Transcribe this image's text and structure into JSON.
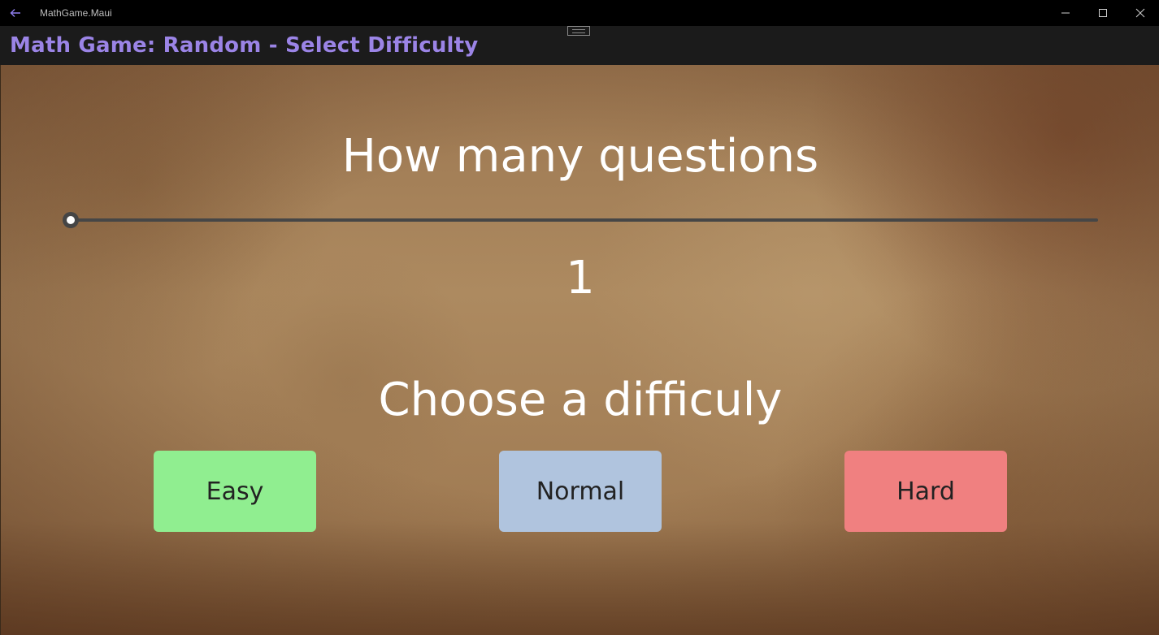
{
  "window": {
    "app_title": "MathGame.Maui",
    "icons": {
      "back": "back-arrow-icon",
      "minimize": "minimize-icon",
      "maximize": "maximize-icon",
      "close": "close-icon"
    },
    "accent_color": "#9b84e6"
  },
  "header": {
    "title": "Math Game: Random - Select Difficulty"
  },
  "main": {
    "questions_heading": "How many questions",
    "questions_slider": {
      "value": 1,
      "minimum": 1,
      "display_value": "1"
    },
    "difficulty_heading": "Choose a difficuly",
    "difficulty_buttons": [
      {
        "label": "Easy",
        "color": "#90ee90"
      },
      {
        "label": "Normal",
        "color": "#b0c4de"
      },
      {
        "label": "Hard",
        "color": "#f08080"
      }
    ]
  }
}
